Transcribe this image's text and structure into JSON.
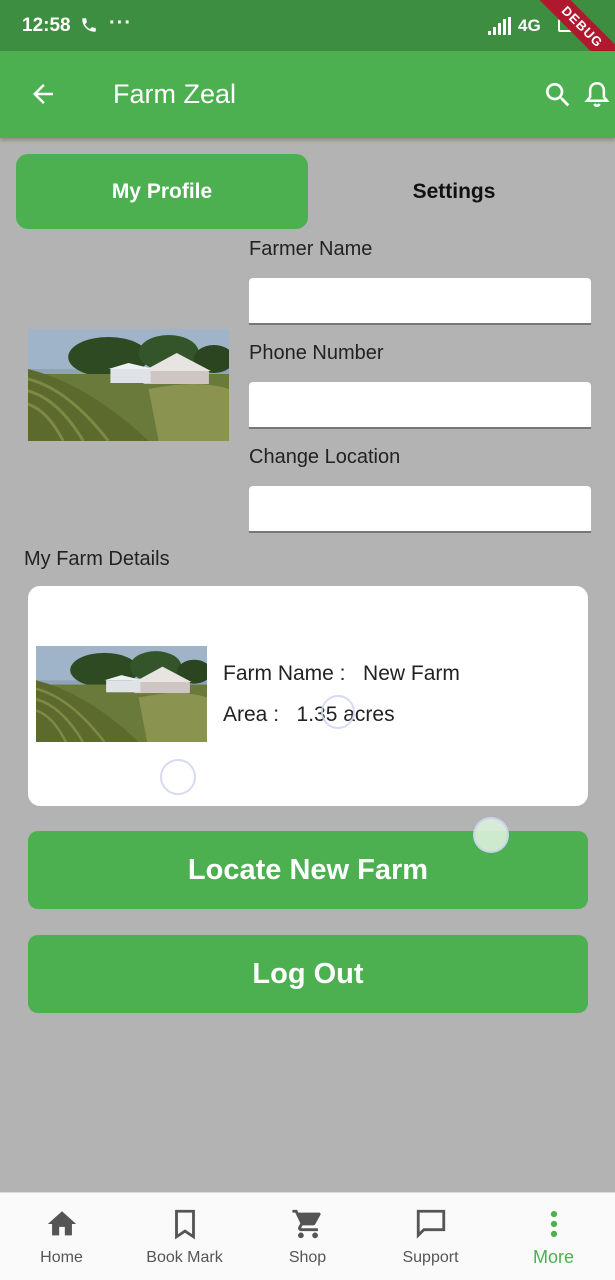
{
  "status_bar": {
    "time": "12:58",
    "overflow": "···",
    "network": "4G",
    "debug_banner": "DEBUG"
  },
  "app_bar": {
    "title": "Farm Zeal",
    "icons": [
      "back-arrow-icon",
      "search-icon",
      "bell-icon"
    ]
  },
  "tabs": [
    {
      "label": "My Profile",
      "active": true
    },
    {
      "label": "Settings",
      "active": false
    }
  ],
  "profile_form": {
    "fields": [
      {
        "label": "Farmer Name",
        "value": ""
      },
      {
        "label": "Phone Number",
        "value": ""
      },
      {
        "label": "Change Location",
        "value": ""
      }
    ]
  },
  "farm_details": {
    "section_title": "My Farm Details",
    "farm_name_label": "Farm Name :",
    "farm_name_value": "New Farm",
    "area_label": "Area :",
    "area_value": "1.35 acres"
  },
  "actions": {
    "locate_new_farm": "Locate New Farm",
    "log_out": "Log Out"
  },
  "bottom_nav": [
    {
      "label": "Home",
      "icon": "home-icon"
    },
    {
      "label": "Book Mark",
      "icon": "bookmark-icon"
    },
    {
      "label": "Shop",
      "icon": "cart-icon"
    },
    {
      "label": "Support",
      "icon": "chat-icon"
    },
    {
      "label": "More",
      "icon": "more-vertical-icon",
      "active": true
    }
  ],
  "colors": {
    "primary": "#4caf50",
    "status_bar": "#3e8e41",
    "background": "#b3b3b3",
    "card": "#ffffff",
    "debug_ribbon": "#b0182d"
  }
}
